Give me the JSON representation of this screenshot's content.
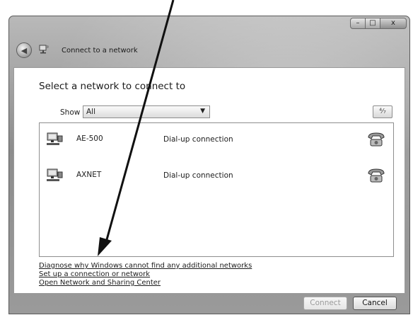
{
  "window": {
    "title": "Connect to a network",
    "caption_buttons": {
      "minimize": "–",
      "maximize": "□",
      "close": "x"
    }
  },
  "heading": "Select a network to connect to",
  "filter": {
    "label": "Show",
    "selected": "All",
    "refresh_icon": "refresh-icon"
  },
  "networks": [
    {
      "name": "AE-500",
      "type": "Dial-up connection",
      "icon": "network-adapter-icon",
      "status_icon": "telephone-icon"
    },
    {
      "name": "AXNET",
      "type": "Dial-up connection",
      "icon": "network-adapter-icon",
      "status_icon": "telephone-icon"
    }
  ],
  "links": [
    "Diagnose why Windows cannot find any additional networks",
    "Set up a connection or network",
    "Open Network and Sharing Center"
  ],
  "buttons": {
    "connect": "Connect",
    "cancel": "Cancel"
  }
}
